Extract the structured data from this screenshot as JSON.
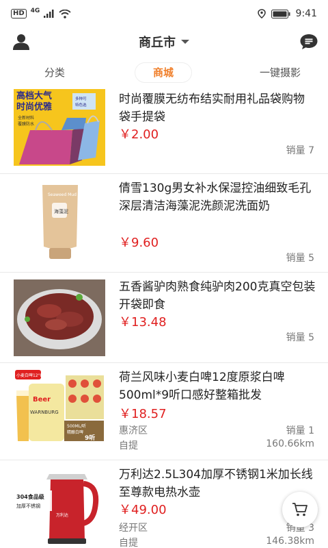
{
  "statusbar": {
    "hd": "HD",
    "network": "4G",
    "time": "9:41"
  },
  "header": {
    "city": "商丘市"
  },
  "tabs": [
    {
      "label": "分类",
      "active": false
    },
    {
      "label": "商城",
      "active": true
    },
    {
      "label": "一键摄影",
      "active": false
    }
  ],
  "colors": {
    "accent": "#f07f2a",
    "price": "#e02020"
  },
  "products": [
    {
      "title": "时尚覆膜无纺布结实耐用礼品袋购物袋手提袋",
      "price": "￥2.00",
      "sales": "销量 7",
      "image_text": [
        "高档大气",
        "时尚优雅",
        "全新材料",
        "覆膜防水",
        "多种可",
        "特色选"
      ]
    },
    {
      "title": "倩雪130g男女补水保湿控油细致毛孔深层清洁海藻泥洗颜泥洗面奶",
      "price": "￥9.60",
      "sales": "销量 5",
      "image_text": [
        "Seaweed Mud",
        "海藻泥"
      ]
    },
    {
      "title": "五香酱驴肉熟食纯驴肉200克真空包装开袋即食",
      "price": "￥13.48",
      "sales": "销量 5"
    },
    {
      "title": "荷兰风味小麦白啤12度原浆白啤500ml*9听口感好整箱批发",
      "price": "￥18.57",
      "sales": "销量 1",
      "region": "惠济区",
      "pickup": "自提",
      "distance": "160.66km",
      "image_text": [
        "小麦白啤12°P",
        "Beer",
        "WARNBURG",
        "500ML/听",
        "精酿白啤",
        "9听"
      ]
    },
    {
      "title": "万利达2.5L304加厚不锈钢1米加长线至尊款电热水壶",
      "price": "￥49.00",
      "sales": "销量 3",
      "region": "经开区",
      "pickup": "自提",
      "distance": "146.38km",
      "image_text": [
        "304食品级",
        "加厚不锈钢",
        "万利达"
      ]
    }
  ]
}
